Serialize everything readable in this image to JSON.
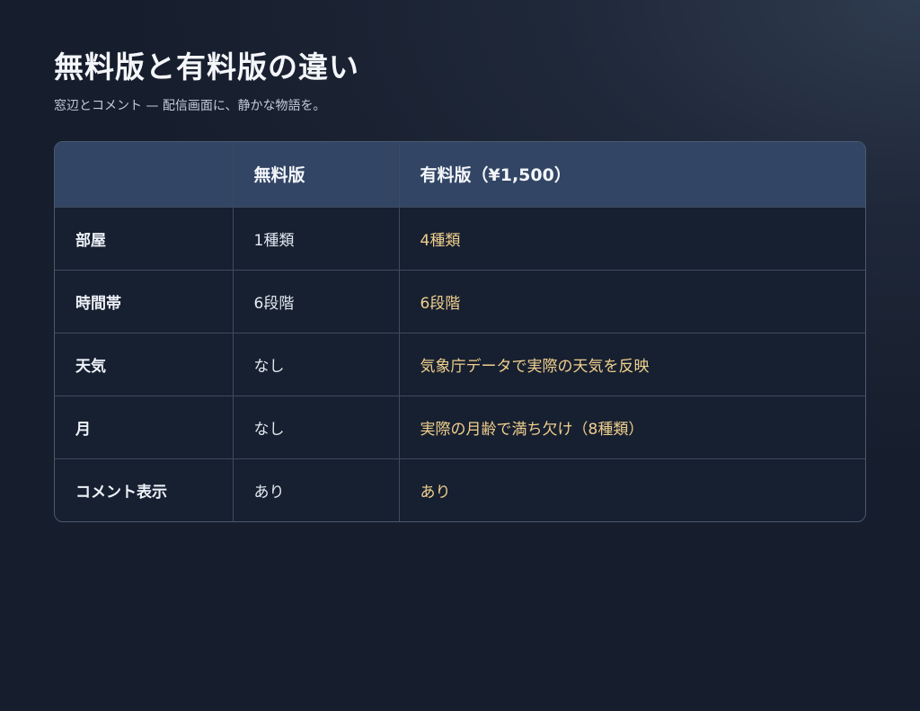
{
  "title": "無料版と有料版の違い",
  "subtitle": "窓辺とコメント — 配信画面に、静かな物語を。",
  "colors": {
    "background": "#161d2c",
    "header_row": "#324564",
    "paid_text": "#f0cf8e"
  },
  "table": {
    "headers": [
      "",
      "無料版",
      "有料版（¥1,500）"
    ],
    "rows": [
      {
        "feature": "部屋",
        "free": "1種類",
        "paid": "4種類"
      },
      {
        "feature": "時間帯",
        "free": "6段階",
        "paid": "6段階"
      },
      {
        "feature": "天気",
        "free": "なし",
        "paid": "気象庁データで実際の天気を反映"
      },
      {
        "feature": "月",
        "free": "なし",
        "paid": "実際の月齢で満ち欠け（8種類）"
      },
      {
        "feature": "コメント表示",
        "free": "あり",
        "paid": "あり"
      }
    ]
  }
}
